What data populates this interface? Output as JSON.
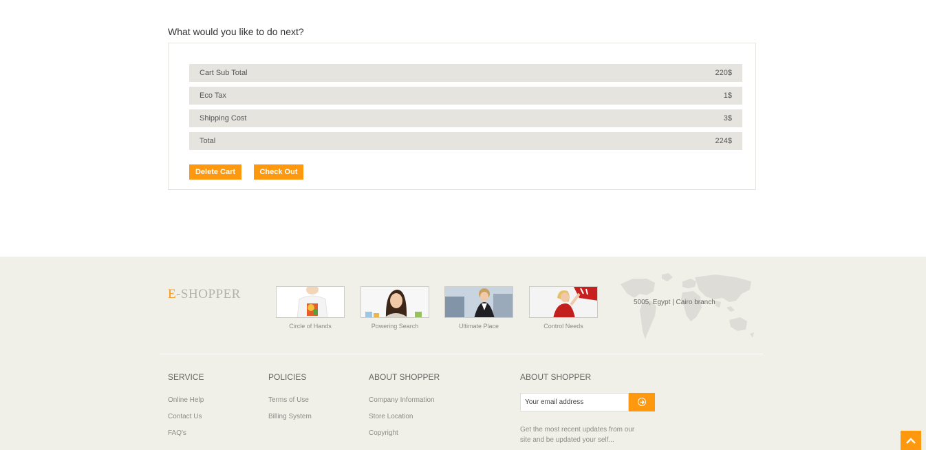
{
  "heading": "What would you like to do next?",
  "cart_summary": [
    {
      "label": "Cart Sub Total",
      "value": "220$"
    },
    {
      "label": "Eco Tax",
      "value": "1$"
    },
    {
      "label": "Shipping Cost",
      "value": "3$"
    },
    {
      "label": "Total",
      "value": "224$"
    }
  ],
  "buttons": {
    "delete": "Delete Cart",
    "checkout": "Check Out"
  },
  "footer": {
    "logo_first": "E",
    "logo_rest": "-SHOPPER",
    "videos": [
      "Circle of Hands",
      "Powering Search",
      "Ultimate Place",
      "Control Needs"
    ],
    "address": "5005, Egypt | Cairo branch",
    "columns": [
      {
        "title": "SERVICE",
        "links": [
          "Online Help",
          "Contact Us",
          "FAQ's"
        ]
      },
      {
        "title": "POLICIES",
        "links": [
          "Terms of Use",
          "Billing System"
        ]
      },
      {
        "title": "ABOUT SHOPPER",
        "links": [
          "Company Information",
          "Store Location",
          "Copyright"
        ]
      }
    ],
    "newsletter": {
      "title": "ABOUT SHOPPER",
      "placeholder": "Your email address",
      "text": "Get the most recent updates from our site and be updated your self..."
    }
  },
  "colors": {
    "accent": "#fe980f",
    "footer_bg": "#f0f0e9",
    "row_bg": "#e6e4df"
  }
}
